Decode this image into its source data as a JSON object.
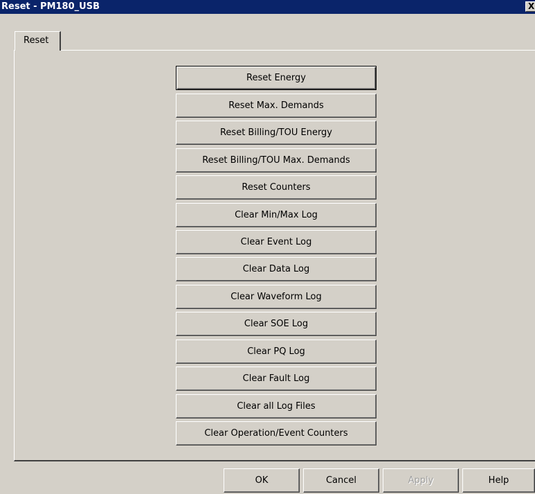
{
  "window": {
    "title": "Reset - PM180_USB",
    "close_label": "X"
  },
  "tabs": [
    {
      "label": "Reset"
    }
  ],
  "reset_buttons": [
    {
      "label": "Reset Energy"
    },
    {
      "label": "Reset Max. Demands"
    },
    {
      "label": "Reset Billing/TOU Energy"
    },
    {
      "label": "Reset Billing/TOU Max. Demands"
    },
    {
      "label": "Reset Counters"
    },
    {
      "label": "Clear Min/Max Log"
    },
    {
      "label": "Clear Event Log"
    },
    {
      "label": "Clear Data Log"
    },
    {
      "label": "Clear Waveform Log"
    },
    {
      "label": "Clear SOE Log"
    },
    {
      "label": "Clear PQ Log"
    },
    {
      "label": "Clear Fault Log"
    },
    {
      "label": "Clear all Log Files"
    },
    {
      "label": "Clear Operation/Event Counters"
    }
  ],
  "footer": {
    "ok_label": "OK",
    "cancel_label": "Cancel",
    "apply_label": "Apply",
    "help_label": "Help"
  }
}
